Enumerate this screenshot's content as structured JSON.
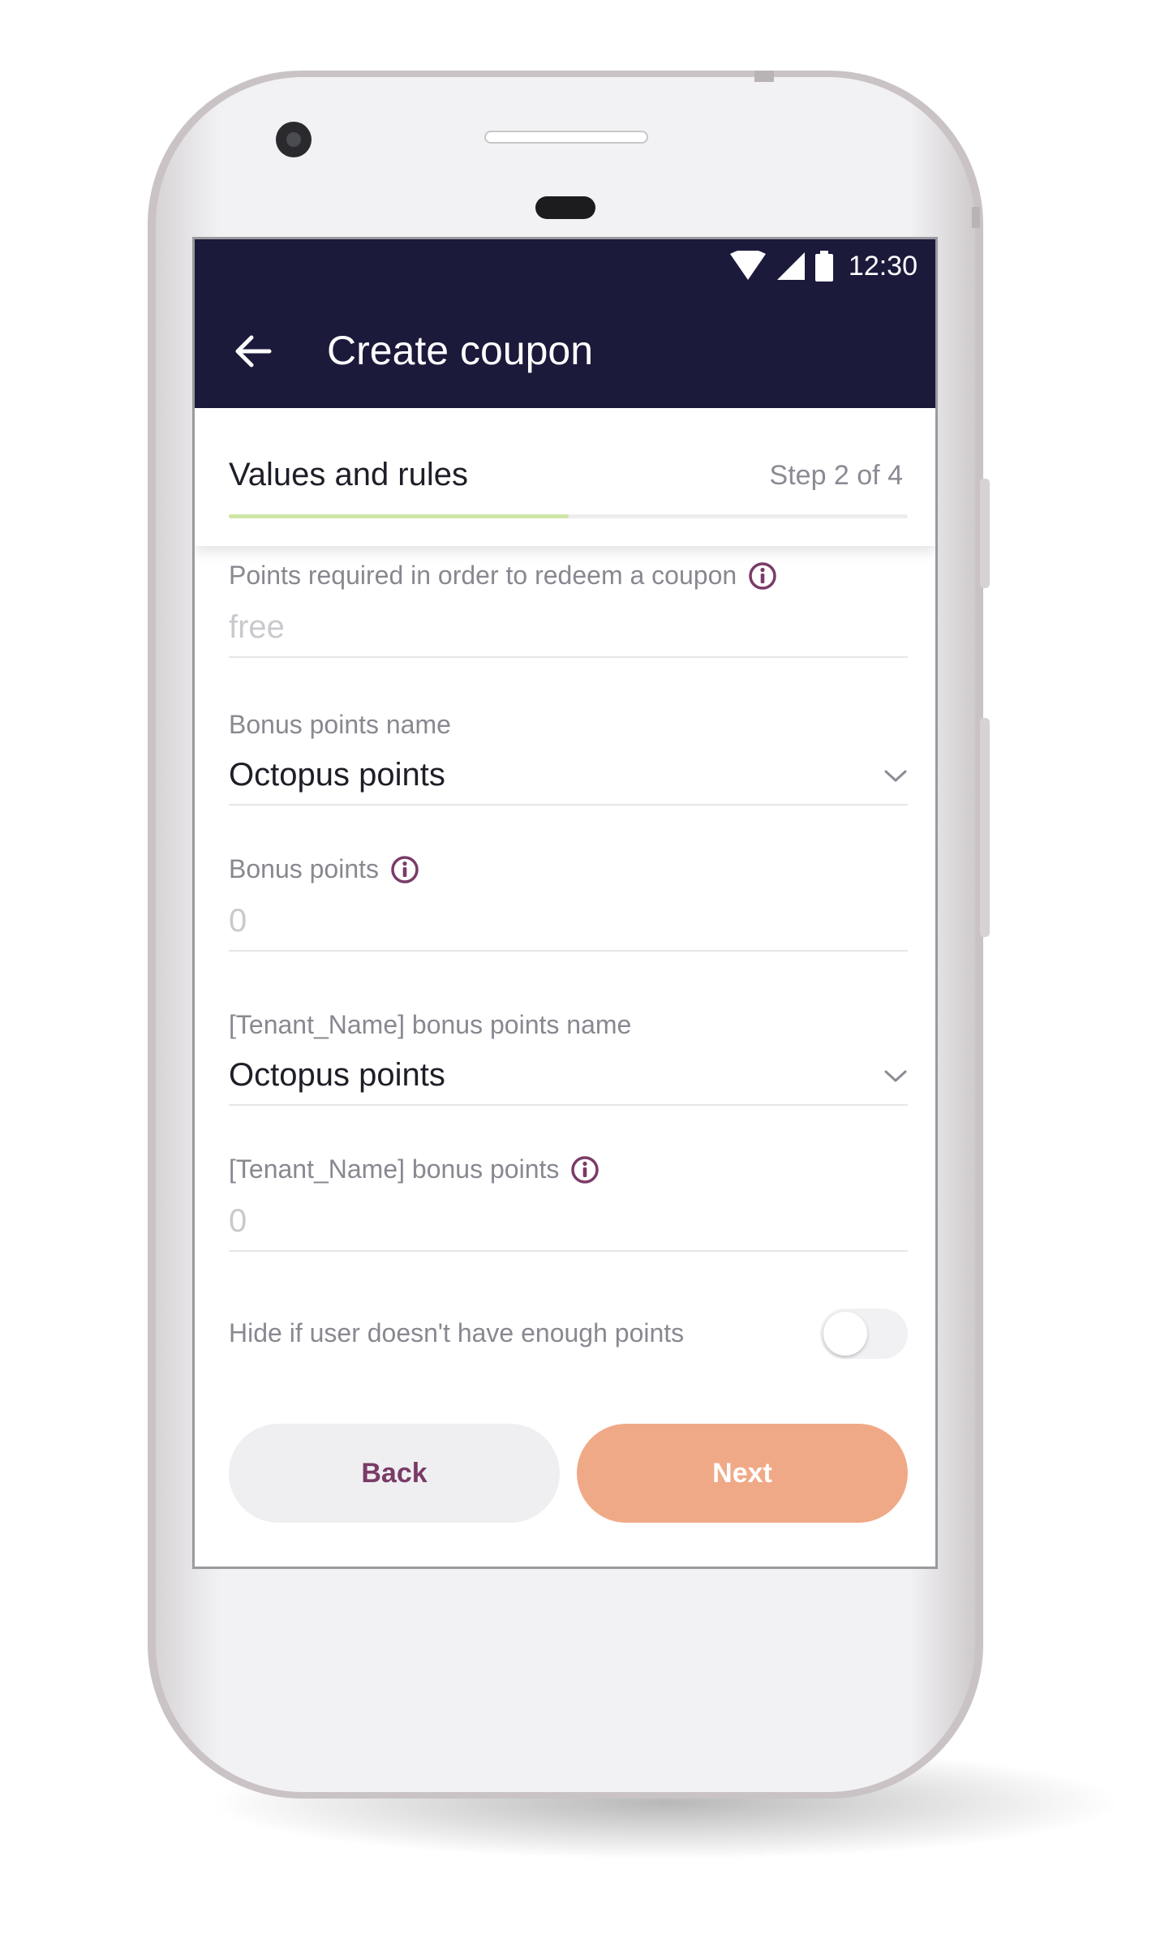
{
  "status_bar": {
    "time": "12:30",
    "icons": [
      "wifi-icon",
      "signal-icon",
      "battery-icon"
    ]
  },
  "toolbar": {
    "back_icon": "arrow-left-icon",
    "title": "Create coupon"
  },
  "stepper": {
    "title": "Values and rules",
    "step_label": "Step 2 of 4",
    "progress_fraction": 0.5
  },
  "form": {
    "points_required": {
      "label": "Points required in order to redeem a coupon",
      "placeholder": "free",
      "info_icon": "info-icon"
    },
    "bonus_points_name": {
      "label": "Bonus points name",
      "value": "Octopus points",
      "dropdown_icon": "chevron-down-icon"
    },
    "bonus_points": {
      "label": "Bonus points",
      "placeholder": "0",
      "info_icon": "info-icon"
    },
    "tenant_bonus_points_name": {
      "label": "[Tenant_Name] bonus points name",
      "value": "Octopus points",
      "dropdown_icon": "chevron-down-icon"
    },
    "tenant_bonus_points": {
      "label": "[Tenant_Name] bonus points",
      "placeholder": "0",
      "info_icon": "info-icon"
    },
    "hide_toggle": {
      "label": "Hide if user doesn't have enough points",
      "on": false
    }
  },
  "actions": {
    "back_label": "Back",
    "next_label": "Next"
  },
  "colors": {
    "app_bar": "#1c1a3b",
    "progress": "#cfe5a6",
    "accent_purple": "#7a3b67",
    "next_button": "#f0a987",
    "back_button": "#efeff1"
  }
}
